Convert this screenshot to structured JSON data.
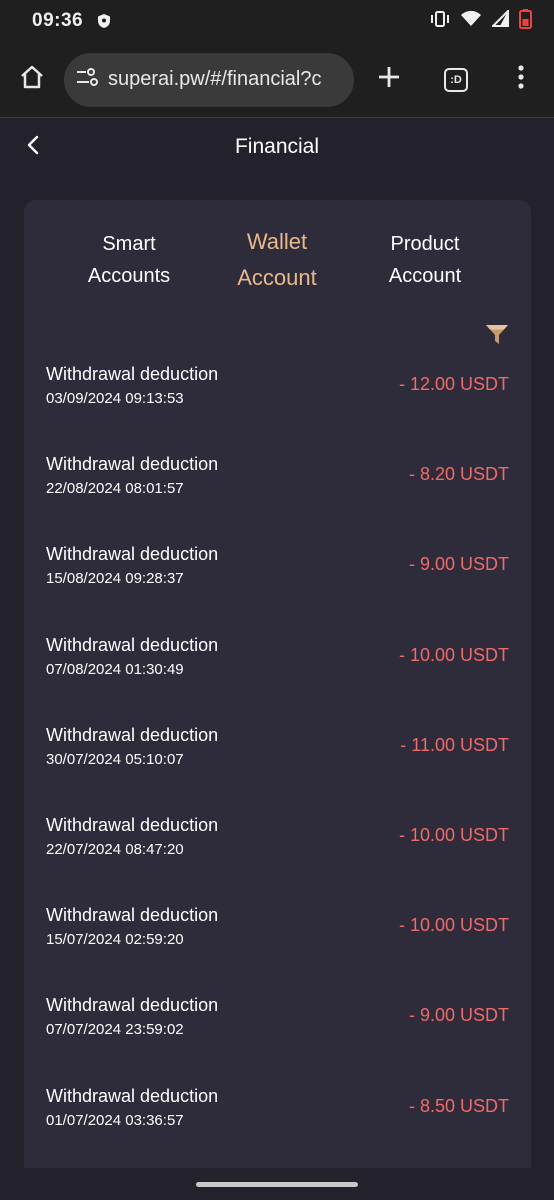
{
  "status_bar": {
    "time": "09:36",
    "icons": [
      "shield-icon",
      "vibrate-icon",
      "wifi-icon",
      "signal-icon",
      "battery-low-icon"
    ]
  },
  "browser": {
    "url": "superai.pw/#/financial?c",
    "tabs_label": ":D",
    "icons": [
      "home-icon",
      "site-settings-icon",
      "plus-icon",
      "tabs-icon",
      "more-vert-icon"
    ]
  },
  "header": {
    "title": "Financial",
    "back_icon": "chevron-left-icon"
  },
  "tabs": [
    {
      "line1": "Smart",
      "line2": "Accounts",
      "active": false
    },
    {
      "line1": "Wallet",
      "line2": "Account",
      "active": true
    },
    {
      "line1": "Product",
      "line2": "Account",
      "active": false
    }
  ],
  "filter_icon": "filter-icon",
  "colors": {
    "background": "#23212c",
    "card": "#2e2c3a",
    "accent": "#e9b98b",
    "negative": "#f06a6a"
  },
  "transactions": [
    {
      "title": "Withdrawal deduction",
      "date": "03/09/2024 09:13:53",
      "amount": "- 12.00 USDT"
    },
    {
      "title": "Withdrawal deduction",
      "date": "22/08/2024 08:01:57",
      "amount": "- 8.20 USDT"
    },
    {
      "title": "Withdrawal deduction",
      "date": "15/08/2024 09:28:37",
      "amount": "- 9.00 USDT"
    },
    {
      "title": "Withdrawal deduction",
      "date": "07/08/2024 01:30:49",
      "amount": "- 10.00 USDT"
    },
    {
      "title": "Withdrawal deduction",
      "date": "30/07/2024 05:10:07",
      "amount": "- 11.00 USDT"
    },
    {
      "title": "Withdrawal deduction",
      "date": "22/07/2024 08:47:20",
      "amount": "- 10.00 USDT"
    },
    {
      "title": "Withdrawal deduction",
      "date": "15/07/2024 02:59:20",
      "amount": "- 10.00 USDT"
    },
    {
      "title": "Withdrawal deduction",
      "date": "07/07/2024 23:59:02",
      "amount": "- 9.00 USDT"
    },
    {
      "title": "Withdrawal deduction",
      "date": "01/07/2024 03:36:57",
      "amount": "- 8.50 USDT"
    }
  ]
}
